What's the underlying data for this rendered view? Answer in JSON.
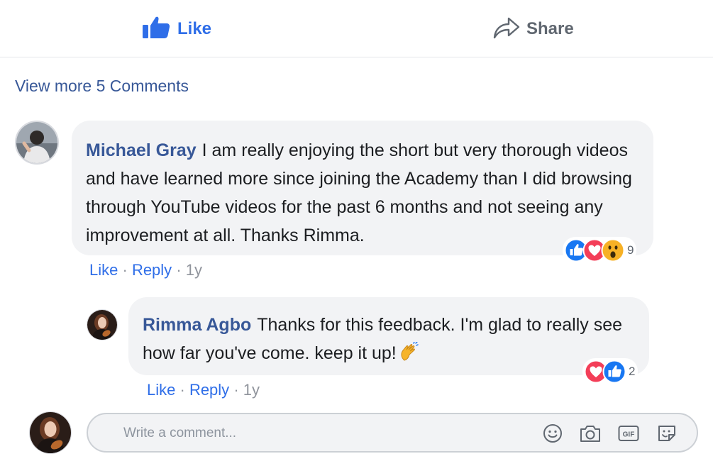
{
  "actions": {
    "like_label": "Like",
    "share_label": "Share"
  },
  "view_more": "View more 5 Comments",
  "comments": [
    {
      "author": "Michael Gray",
      "text": "I am really enjoying the short but very thorough videos and have learned more since joining the Academy than I did browsing through YouTube videos for the past 6 months and not seeing any improvement at all. Thanks Rimma.",
      "reactions": [
        "like-icon",
        "love-icon",
        "wow-icon"
      ],
      "reaction_count": "9",
      "like_label": "Like",
      "reply_label": "Reply",
      "age": "1y",
      "separator": "·"
    },
    {
      "author": "Rimma Agbo",
      "text": "Thanks for this feedback. I'm glad to really see how far you've come. keep it up!",
      "emoji": "clapping-hands-icon",
      "reactions": [
        "love-icon",
        "like-icon"
      ],
      "reaction_count": "2",
      "like_label": "Like",
      "reply_label": "Reply",
      "age": "1y",
      "separator": "·"
    }
  ],
  "composer": {
    "placeholder": "Write a comment...",
    "icons": [
      "emoji-icon",
      "camera-icon",
      "gif-icon",
      "sticker-icon"
    ]
  },
  "colors": {
    "link": "#385898",
    "accent": "#2f6ee8",
    "bubble": "#f2f3f5",
    "like": "#1877f2",
    "love": "#f33e58",
    "wow": "#f7b125"
  }
}
